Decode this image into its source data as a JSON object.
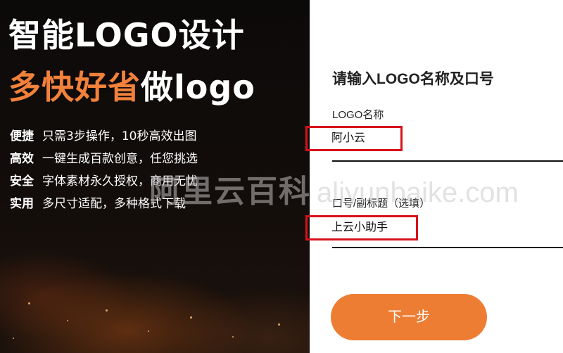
{
  "promo": {
    "headline_line1": "智能LOGO设计",
    "headline_line2_accent": "多快好省",
    "headline_line2_rest": "做logo",
    "accent_color": "#f2813b",
    "features": [
      {
        "key": "便捷",
        "text": "只需3步操作，10秒高效出图"
      },
      {
        "key": "高效",
        "text": "一键生成百款创意，任您挑选"
      },
      {
        "key": "安全",
        "text": "字体素材永久授权，商用无忧"
      },
      {
        "key": "实用",
        "text": "多尺寸适配，多种格式下载"
      }
    ]
  },
  "form": {
    "title": "请输入LOGO名称及口号",
    "name_label": "LOGO名称",
    "name_value": "阿小云",
    "slogan_label": "口号/副标题（选填）",
    "slogan_value": "上云小助手",
    "next_button": "下一步",
    "button_color": "#ee7d34",
    "highlight_color": "#d8121a"
  },
  "watermark": {
    "cn": "阿里云百科",
    "en": "aliyunbaike.com"
  }
}
